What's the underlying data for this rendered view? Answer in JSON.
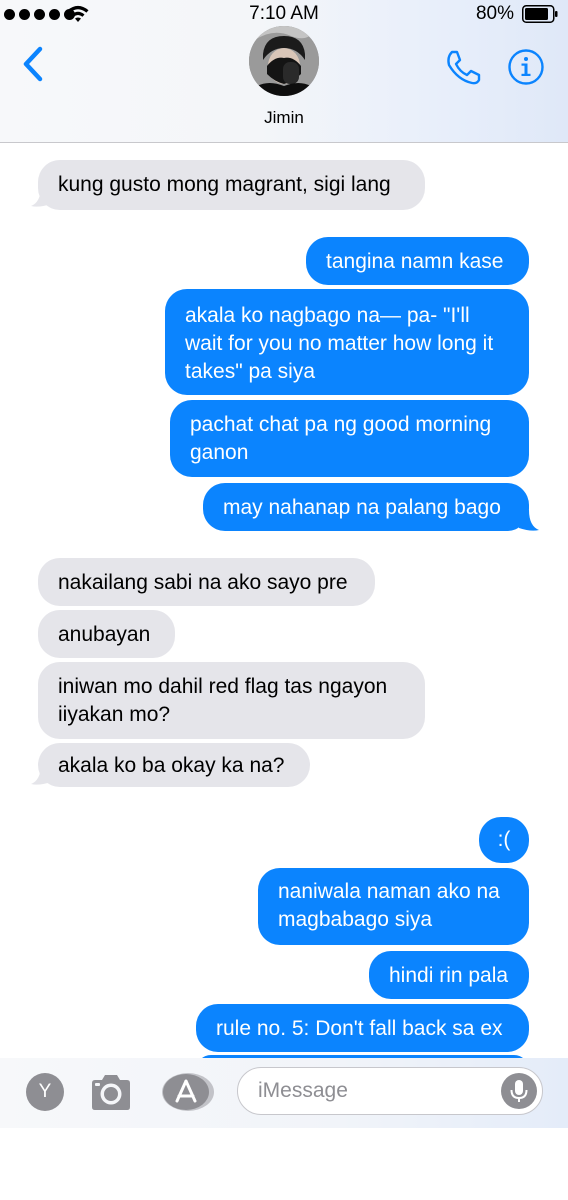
{
  "status_bar": {
    "time": "7:10 AM",
    "battery_percent": "80%",
    "signal_bars": 5,
    "battery_level": 0.8
  },
  "header": {
    "contact_name": "Jimin",
    "icons": [
      "back-chevron-icon",
      "phone-icon",
      "info-icon"
    ],
    "accent_color": "#0b84fe"
  },
  "messages": [
    {
      "side": "in",
      "text": "kung gusto mong magrant, sigi lang"
    },
    {
      "side": "out",
      "text": "tangina namn kase"
    },
    {
      "side": "out",
      "text": "akala ko nagbago na— pa- \"I'll wait for you no matter how long it takes\" pa siya"
    },
    {
      "side": "out",
      "text": "pachat chat pa ng good morning ganon"
    },
    {
      "side": "out",
      "text": "may nahanap na palang bago"
    },
    {
      "side": "in",
      "text": "nakailang sabi na ako sayo pre"
    },
    {
      "side": "in",
      "text": "anubayan"
    },
    {
      "side": "in",
      "text": "iniwan mo dahil red flag tas ngayon iiyakan mo?"
    },
    {
      "side": "in",
      "text": "akala ko ba okay ka na?"
    },
    {
      "side": "out",
      "text": ":("
    },
    {
      "side": "out",
      "text": "naniwala naman ako na magbabago siya"
    },
    {
      "side": "out",
      "text": "hindi rin pala"
    },
    {
      "side": "out",
      "text": "rule no. 5: Don't fall back sa ex"
    }
  ],
  "composer": {
    "apps_label": "Y",
    "placeholder": "iMessage",
    "value": "",
    "icons": [
      "camera-icon",
      "app-store-icon",
      "microphone-icon"
    ]
  },
  "colors": {
    "incoming_bubble": "#e5e5ea",
    "outgoing_bubble": "#0b84fe"
  }
}
